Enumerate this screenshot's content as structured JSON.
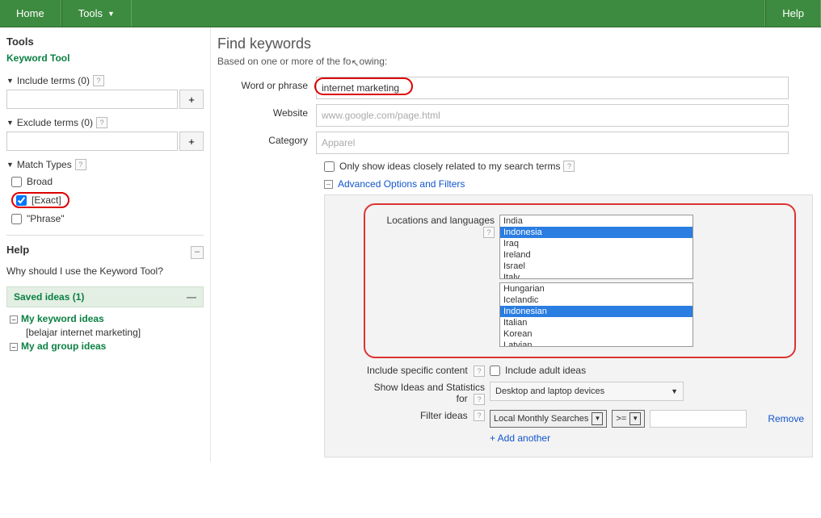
{
  "topbar": {
    "home": "Home",
    "tools": "Tools",
    "help": "Help"
  },
  "sidebar": {
    "tools_heading": "Tools",
    "keyword_tool": "Keyword Tool",
    "include_terms": "Include terms (0)",
    "exclude_terms": "Exclude terms (0)",
    "add_btn": "+",
    "match_types": "Match Types",
    "match": {
      "broad": "Broad",
      "exact": "[Exact]",
      "phrase": "\"Phrase\""
    },
    "help_heading": "Help",
    "help_q": "Why should I use the Keyword Tool?",
    "saved_ideas": "Saved ideas (1)",
    "my_keyword_ideas": "My keyword ideas",
    "keyword_example": "[belajar internet marketing]",
    "my_ad_group_ideas": "My ad group ideas"
  },
  "main": {
    "title": "Find keywords",
    "subtitle_pre": "Based on one or more of the fo",
    "subtitle_post": "owing:",
    "word_label": "Word or phrase",
    "word_value": "internet marketing",
    "website_label": "Website",
    "website_placeholder": "www.google.com/page.html",
    "category_label": "Category",
    "category_placeholder": "Apparel",
    "only_related": "Only show ideas closely related to my search terms",
    "adv_toggle": "Advanced Options and Filters",
    "loc_lang_label": "Locations and languages",
    "locations": [
      "India",
      "Indonesia",
      "Iraq",
      "Ireland",
      "Israel",
      "Italy"
    ],
    "location_selected": "Indonesia",
    "languages": [
      "Hungarian",
      "Icelandic",
      "Indonesian",
      "Italian",
      "Korean",
      "Latvian"
    ],
    "language_selected": "Indonesian",
    "include_specific": "Include specific content",
    "include_adult": "Include adult ideas",
    "show_ideas_label": "Show Ideas and Statistics for",
    "devices": "Desktop and laptop devices",
    "filter_label": "Filter ideas",
    "filter_metric": "Local Monthly Searches",
    "filter_op": ">=",
    "remove": "Remove",
    "add_another": "+ Add another"
  }
}
